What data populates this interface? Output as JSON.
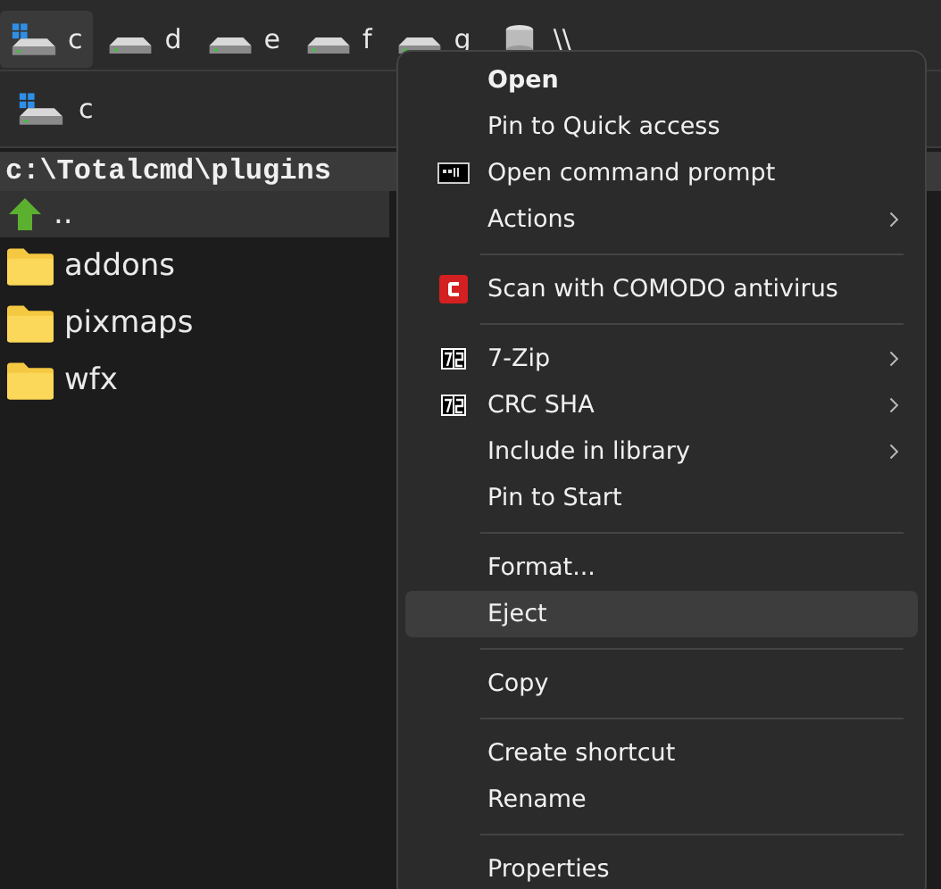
{
  "drive_tabs": [
    {
      "label": "c",
      "kind": "system",
      "selected": true
    },
    {
      "label": "d",
      "kind": "drive",
      "selected": false
    },
    {
      "label": "e",
      "kind": "drive",
      "selected": false
    },
    {
      "label": "f",
      "kind": "drive",
      "selected": false
    },
    {
      "label": "g",
      "kind": "drive",
      "selected": false
    },
    {
      "label": "\\\\",
      "kind": "network",
      "selected": false
    }
  ],
  "current_drive": {
    "label": "c"
  },
  "path": "c:\\Totalcmd\\plugins",
  "files": [
    {
      "name": "..",
      "kind": "up",
      "selected": true
    },
    {
      "name": "addons",
      "kind": "folder",
      "selected": false
    },
    {
      "name": "pixmaps",
      "kind": "folder",
      "selected": false
    },
    {
      "name": "wfx",
      "kind": "folder",
      "selected": false
    }
  ],
  "context_menu": [
    {
      "kind": "item",
      "label": "Open",
      "bold": true,
      "submenu": false,
      "selected": false
    },
    {
      "kind": "item",
      "label": "Pin to Quick access",
      "bold": false,
      "submenu": false,
      "selected": false
    },
    {
      "kind": "terminal",
      "label": "Open command prompt",
      "bold": false,
      "submenu": false,
      "selected": false
    },
    {
      "kind": "item",
      "label": "Actions",
      "bold": false,
      "submenu": true,
      "selected": false
    },
    {
      "kind": "separator"
    },
    {
      "kind": "antivirus",
      "label": "Scan with COMODO antivirus",
      "bold": false,
      "submenu": false,
      "selected": false
    },
    {
      "kind": "separator"
    },
    {
      "kind": "archive",
      "label": "7-Zip",
      "bold": false,
      "submenu": true,
      "selected": false
    },
    {
      "kind": "archive",
      "label": "CRC SHA",
      "bold": false,
      "submenu": true,
      "selected": false
    },
    {
      "kind": "item",
      "label": "Include in library",
      "bold": false,
      "submenu": true,
      "selected": false
    },
    {
      "kind": "item",
      "label": "Pin to Start",
      "bold": false,
      "submenu": false,
      "selected": false
    },
    {
      "kind": "separator"
    },
    {
      "kind": "item",
      "label": "Format...",
      "bold": false,
      "submenu": false,
      "selected": false
    },
    {
      "kind": "item",
      "label": "Eject",
      "bold": false,
      "submenu": false,
      "selected": true
    },
    {
      "kind": "separator"
    },
    {
      "kind": "item",
      "label": "Copy",
      "bold": false,
      "submenu": false,
      "selected": false
    },
    {
      "kind": "separator"
    },
    {
      "kind": "item",
      "label": "Create shortcut",
      "bold": false,
      "submenu": false,
      "selected": false
    },
    {
      "kind": "item",
      "label": "Rename",
      "bold": false,
      "submenu": false,
      "selected": false
    },
    {
      "kind": "separator"
    },
    {
      "kind": "item",
      "label": "Properties",
      "bold": false,
      "submenu": false,
      "selected": false
    }
  ]
}
